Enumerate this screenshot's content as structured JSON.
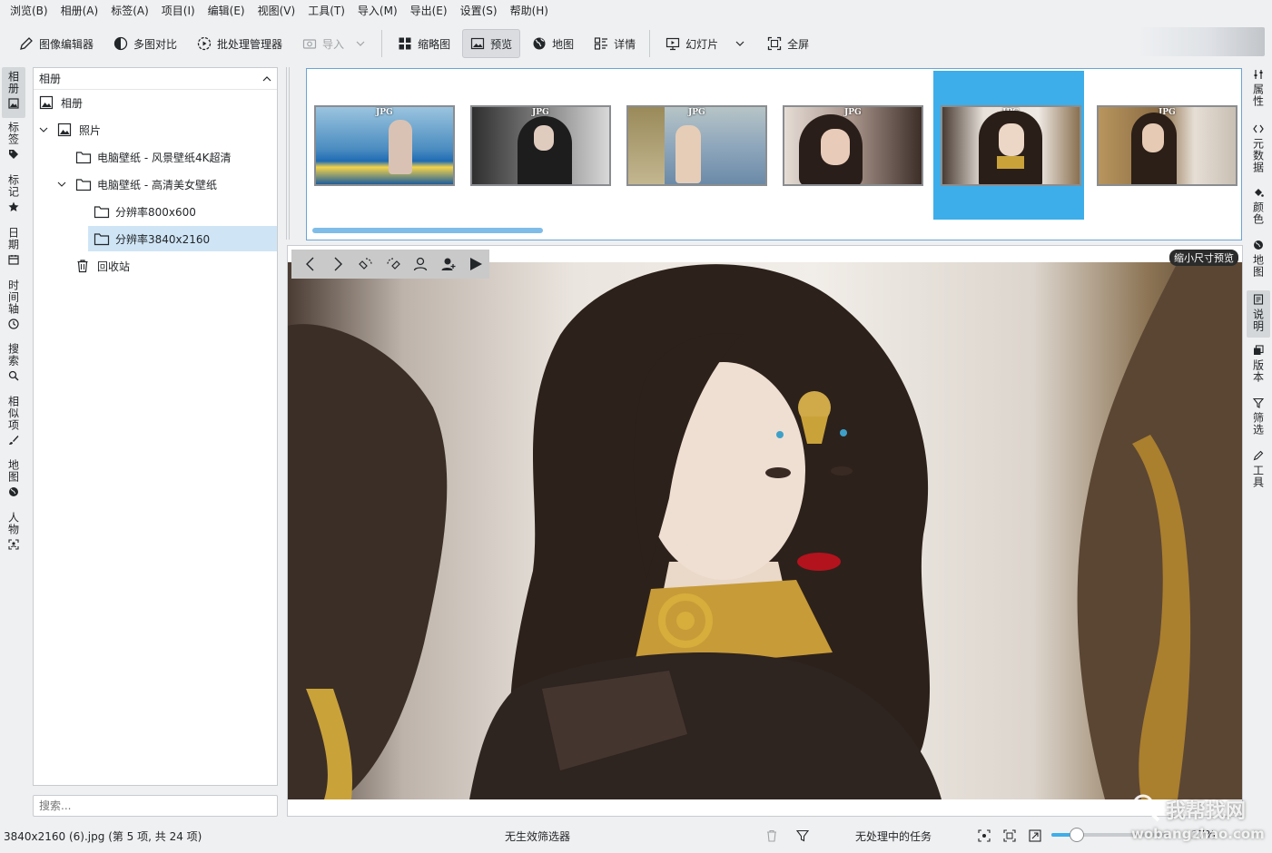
{
  "menu": [
    "浏览(B)",
    "相册(A)",
    "标签(A)",
    "项目(I)",
    "编辑(E)",
    "视图(V)",
    "工具(T)",
    "导入(M)",
    "导出(E)",
    "设置(S)",
    "帮助(H)"
  ],
  "toolbar": {
    "image_editor": "图像编辑器",
    "compare": "多图对比",
    "batch": "批处理管理器",
    "import": "导入",
    "thumbnails": "缩略图",
    "preview": "预览",
    "map": "地图",
    "details": "详情",
    "slideshow": "幻灯片",
    "fullscreen": "全屏"
  },
  "left_tabs": [
    "相册",
    "标签",
    "标记",
    "日期",
    "时间轴",
    "搜索",
    "相似项",
    "地图",
    "人物"
  ],
  "right_tabs": [
    "属性",
    "元数据",
    "颜色",
    "地图",
    "说明",
    "版本",
    "筛选",
    "工具"
  ],
  "album_panel": {
    "header": "相册",
    "root": "相册",
    "photos": "照片",
    "folder1": "电脑壁纸 - 风景壁纸4K超清",
    "folder2": "电脑壁纸 - 高清美女壁纸",
    "sub1": "分辨率800x600",
    "sub2": "分辨率3840x2160",
    "trash": "回收站"
  },
  "search_placeholder": "搜索...",
  "thumbnails": [
    {
      "badge": "JPG",
      "bg": "#4a8cc0"
    },
    {
      "badge": "JPG",
      "bg": "#555555"
    },
    {
      "badge": "JPG",
      "bg": "#8fa7bc"
    },
    {
      "badge": "JPG",
      "bg": "#7a6a60"
    },
    {
      "badge": "JPG",
      "bg": "#e7e1da",
      "selected": true
    },
    {
      "badge": "JPG",
      "bg": "#8a6b44"
    }
  ],
  "preview": {
    "reduced_label": "缩小尺寸预览"
  },
  "status": {
    "file_info": "3840x2160 (6).jpg (第 5 项, 共 24 项)",
    "filter": "无生效筛选器",
    "tasks": "无处理中的任务",
    "zoom": "27%"
  },
  "watermark": {
    "line1": "我帮找网",
    "line2": "wobangzhao.com"
  },
  "colors": {
    "accent": "#3daee9",
    "selected_row": "#cfe5f6"
  }
}
